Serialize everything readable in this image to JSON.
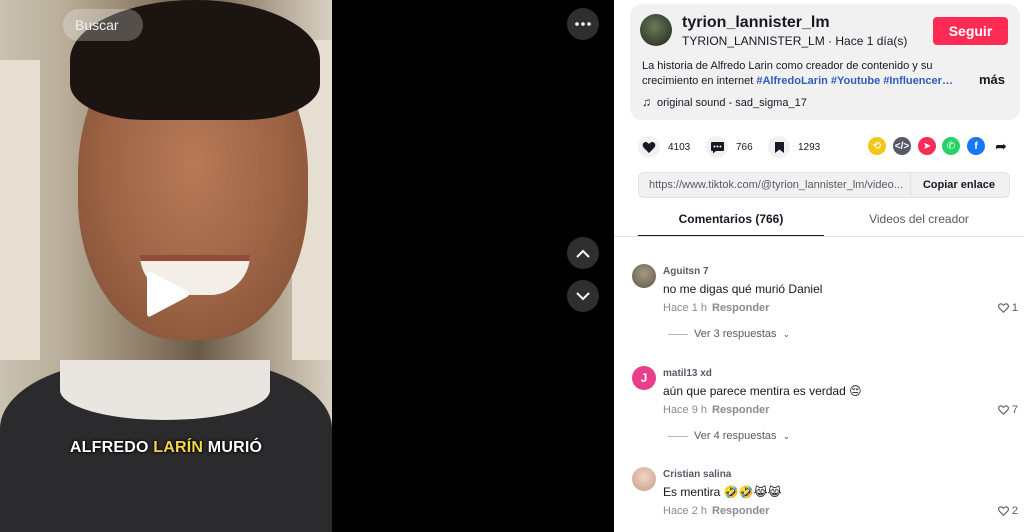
{
  "search": {
    "placeholder": "Buscar"
  },
  "video": {
    "caption_part1": "ALFREDO ",
    "caption_highlight": "LARÍN",
    "caption_part2": " MURIÓ"
  },
  "controls": {
    "more_icon": "more-horizontal-icon",
    "prev_icon": "chevron-up-icon",
    "next_icon": "chevron-down-icon",
    "play_icon": "play-icon"
  },
  "author": {
    "username": "tyrion_lannister_lm",
    "display_name": "TYRION_LANNISTER_LM",
    "separator": " · ",
    "posted": "Hace 1 día(s)",
    "follow_label": "Seguir"
  },
  "post": {
    "description": "La historia de Alfredo Larin como creador de contenido y su crecimiento en internet ",
    "hashtags": "#AlfredoLarin #Youtube #Influencer…",
    "more_label": "más",
    "sound": "original sound - sad_sigma_17"
  },
  "stats": {
    "likes": "4103",
    "comments": "766",
    "saves": "1293"
  },
  "share": {
    "url": "https://www.tiktok.com/@tyrion_lannister_lm/video...",
    "copy_label": "Copiar enlace"
  },
  "tabs": {
    "comments": "Comentarios (766)",
    "creator": "Videos del creador"
  },
  "comments": [
    {
      "user": "Aguitsn 7",
      "text": "no me digas qué murió Daniel",
      "time": "Hace 1 h",
      "reply_label": "Responder",
      "likes": "1",
      "replies_label": "Ver 3 respuestas"
    },
    {
      "user": "matil13 xd",
      "avatar_letter": "J",
      "text": "aún que parece mentira es verdad 😔",
      "time": "Hace 9 h",
      "reply_label": "Responder",
      "likes": "7",
      "replies_label": "Ver 4 respuestas"
    },
    {
      "user": "Cristian salina",
      "text": "Es mentira 🤣🤣😹😹",
      "time": "Hace 2 h",
      "reply_label": "Responder",
      "likes": "2"
    }
  ],
  "colors": {
    "accent": "#fe2c55",
    "hashtag": "#2b5db9",
    "caption_highlight": "#f5d64a"
  }
}
